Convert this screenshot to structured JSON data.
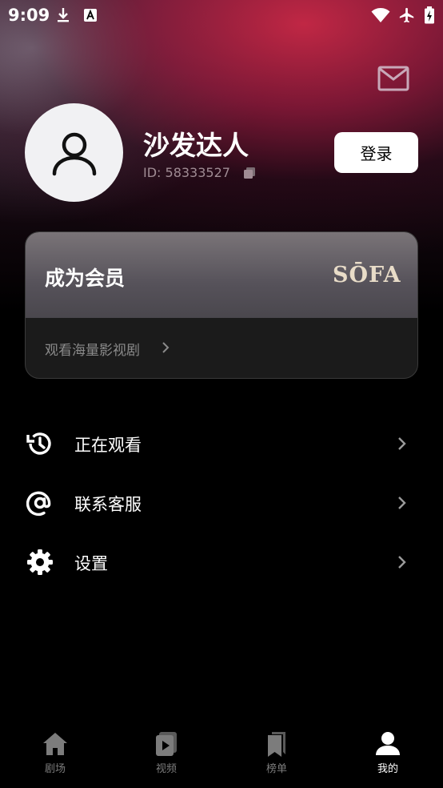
{
  "status_bar": {
    "time": "9:09",
    "icons": [
      "download-icon",
      "a-badge-icon",
      "wifi-icon",
      "airplane-icon",
      "battery-charging-icon"
    ]
  },
  "header": {
    "mail_icon": "mail-icon"
  },
  "profile": {
    "username": "沙发达人",
    "user_id": "ID: 58333527",
    "login_label": "登录"
  },
  "vip_card": {
    "title": "成为会员",
    "logo_text": "SŌFA",
    "subtitle": "观看海量影视剧"
  },
  "menu": [
    {
      "label": "正在观看",
      "icon": "history-icon"
    },
    {
      "label": "联系客服",
      "icon": "at-sign-icon"
    },
    {
      "label": "设置",
      "icon": "gear-icon"
    }
  ],
  "bottom_nav": [
    {
      "label": "剧场",
      "icon": "home-icon",
      "active": false
    },
    {
      "label": "视频",
      "icon": "video-icon",
      "active": false
    },
    {
      "label": "榜单",
      "icon": "bookmark-icon",
      "active": false
    },
    {
      "label": "我的",
      "icon": "person-icon",
      "active": true
    }
  ],
  "colors": {
    "background": "#000000",
    "accent_gradient": "#c8284a",
    "inactive_nav": "#7c7c7c",
    "vip_logo": "#e8dcc8"
  }
}
